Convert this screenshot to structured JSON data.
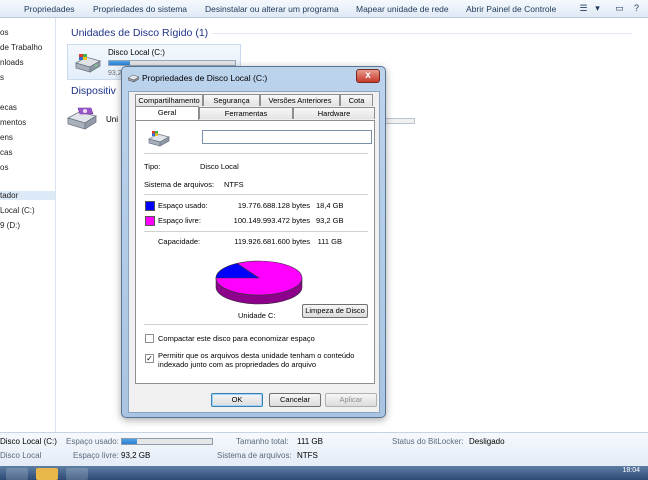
{
  "commandbar": {
    "items": [
      "Propriedades",
      "Propriedades do sistema",
      "Desinstalar ou alterar um programa",
      "Mapear unidade de rede",
      "Abrir Painel de Controle"
    ]
  },
  "nav": {
    "items": [
      "os",
      "de Trabalho",
      "nloads",
      "s",
      "ecas",
      "mentos",
      "ens",
      "cas",
      "os",
      "tador",
      "Local (C:)",
      "9 (D:)"
    ]
  },
  "main": {
    "group_hdd": "Unidades de Disco Rígido (1)",
    "group_removable": "Dispositiv",
    "drive_name": "Disco Local (C:)",
    "drive_sub": "93,2",
    "drive_fill": 0.165,
    "dvd_label": "Uni"
  },
  "status": {
    "drive_name": "Disco Local (C:)",
    "drive_type": "Disco Local",
    "used_label": "Espaço usado:",
    "used_fraction": 0.165,
    "free_label": "Espaço livre:",
    "free_value": "93,2 GB",
    "total_label": "Tamanho total:",
    "total_value": "111 GB",
    "fs_label": "Sistema de arquivos:",
    "fs_value": "NTFS",
    "bitlocker_label": "Status do BitLocker:",
    "bitlocker_value": "Desligado"
  },
  "taskbar": {
    "clock": "18:04"
  },
  "dialog": {
    "title": "Propriedades de Disco Local (C:)",
    "close_label": "x",
    "tabs_row1": [
      "Compartilhamento",
      "Segurança",
      "Versões Anteriores",
      "Cota"
    ],
    "tabs_row2": [
      "Geral",
      "Ferramentas",
      "Hardware"
    ],
    "name_value": "",
    "tipo_label": "Tipo:",
    "tipo_value": "Disco Local",
    "fs_label": "Sistema de arquivos:",
    "fs_value": "NTFS",
    "used_label": "Espaço usado:",
    "used_bytes": "19.776.688.128 bytes",
    "used_gb": "18,4 GB",
    "free_label": "Espaço livre:",
    "free_bytes": "100.149.993.472 bytes",
    "free_gb": "93,2 GB",
    "cap_label": "Capacidade:",
    "cap_bytes": "119.926.681.600 bytes",
    "cap_gb": "111 GB",
    "unit_label": "Unidade C:",
    "cleanup_button": "Limpeza de Disco",
    "compress_label": "Compactar este disco para economizar espaço",
    "compress_checked": false,
    "index_label_1": "Permitir que os arquivos desta unidade tenham o conteúdo",
    "index_label_2": "indexado junto com as propriedades do arquivo",
    "index_checked": true,
    "ok_button": "OK",
    "cancel_button": "Cancelar",
    "apply_button": "Aplicar",
    "colors": {
      "used": "#0000ff",
      "free": "#ff00ff"
    }
  }
}
